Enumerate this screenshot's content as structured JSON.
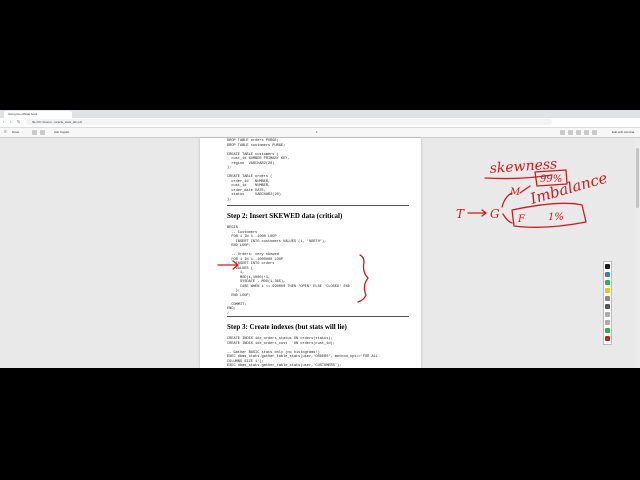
{
  "browser": {
    "tab_title": "Using the official book",
    "url": "file:///C:/Users/.../oracle_stats_lab.pdf",
    "pdf_toolbar": {
      "draw_label": "Draw",
      "ask_copilot_label": "Ask Copilot",
      "page_counter": "1",
      "edit_label": "Edit with Acrobat"
    }
  },
  "document": {
    "code_setup": "DROP TABLE orders PURGE;\nDROP TABLE customers PURGE;\n\nCREATE TABLE customers (\n  cust_id NUMBER PRIMARY KEY,\n  region  VARCHAR2(20)\n);\n\nCREATE TABLE orders (\n  order_id   NUMBER,\n  cust_id    NUMBER,\n  order_date DATE,\n  status     VARCHAR2(20)\n);",
    "step2_heading": "Step 2: Insert SKEWED data (critical)",
    "code_insert": "BEGIN\n  -- Customers\n  FOR i IN 1..1000 LOOP\n    INSERT INTO customers VALUES (i, 'NORTH');\n  END LOOP;\n\n  -- Orders: very skewed\n  FOR i IN 1..1000000 LOOP\n    INSERT INTO orders\n    VALUES (\n      i,\n      MOD(i,1000)+1,\n      SYSDATE - MOD(i,365),\n      CASE WHEN i <= 990000 THEN 'OPEN' ELSE 'CLOSED' END\n    );\n  END LOOP;\n\n  COMMIT;\nEND;\n/",
    "step3_heading": "Step 3: Create indexes (but stats will lie)",
    "code_index": "CREATE INDEX idx_orders_status ON orders(status);\nCREATE INDEX idx_orders_cust   ON orders(cust_id);\n\n-- Gather BASIC stats only (no histograms!)\nEXEC dbms_stats.gather_table_stats(user,'ORDERS', method_opt=>'FOR ALL\nCOLUMNS SIZE 1');\nEXEC dbms_stats.gather_table_stats(user,'CUSTOMERS');"
  },
  "annotations": {
    "skewness": "skewness",
    "percent": "99%",
    "imbalance": "Imbalance",
    "one_percent": "1%",
    "letter_t": "T",
    "letter_g": "G",
    "letter_m": "M",
    "letter_f": "F",
    "ink_color": "#d11a1a"
  },
  "palette": {
    "colors": [
      "#1a1a1a",
      "#3a7bd5",
      "#2bb24c",
      "#f2c200",
      "#d11a1a"
    ]
  }
}
